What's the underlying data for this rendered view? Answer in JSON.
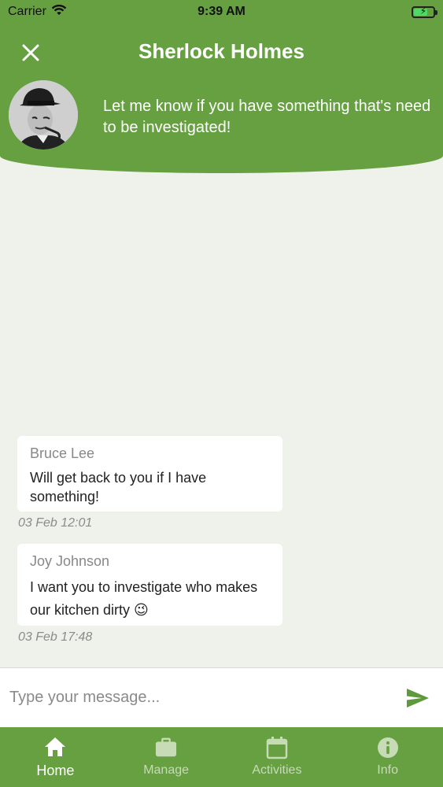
{
  "status_bar": {
    "carrier": "Carrier",
    "time": "9:39 AM",
    "wifi_icon": "wifi-icon",
    "battery_icon": "battery-charging-icon"
  },
  "header": {
    "title": "Sherlock Holmes",
    "message": "Let me know if you have something that's need to be investigated!",
    "close_icon": "close-icon",
    "background_color": "#66a041"
  },
  "messages": [
    {
      "author": "Bruce Lee",
      "text": "Will get back to you if I have something!",
      "time": "03 Feb 12:01"
    },
    {
      "author": "Joy Johnson",
      "text": "I want you to investigate who makes our kitchen dirty 😉",
      "time": "03 Feb 17:48"
    }
  ],
  "composer": {
    "placeholder": "Type your message...",
    "send_icon": "send-icon"
  },
  "tabs": [
    {
      "label": "Home",
      "icon": "home-icon",
      "active": true
    },
    {
      "label": "Manage",
      "icon": "briefcase-icon",
      "active": false
    },
    {
      "label": "Activities",
      "icon": "calendar-icon",
      "active": false
    },
    {
      "label": "Info",
      "icon": "info-icon",
      "active": false
    }
  ],
  "colors": {
    "brand": "#66a041",
    "chat_background": "#eff2eb",
    "tab_inactive": "#c7dbb7"
  }
}
